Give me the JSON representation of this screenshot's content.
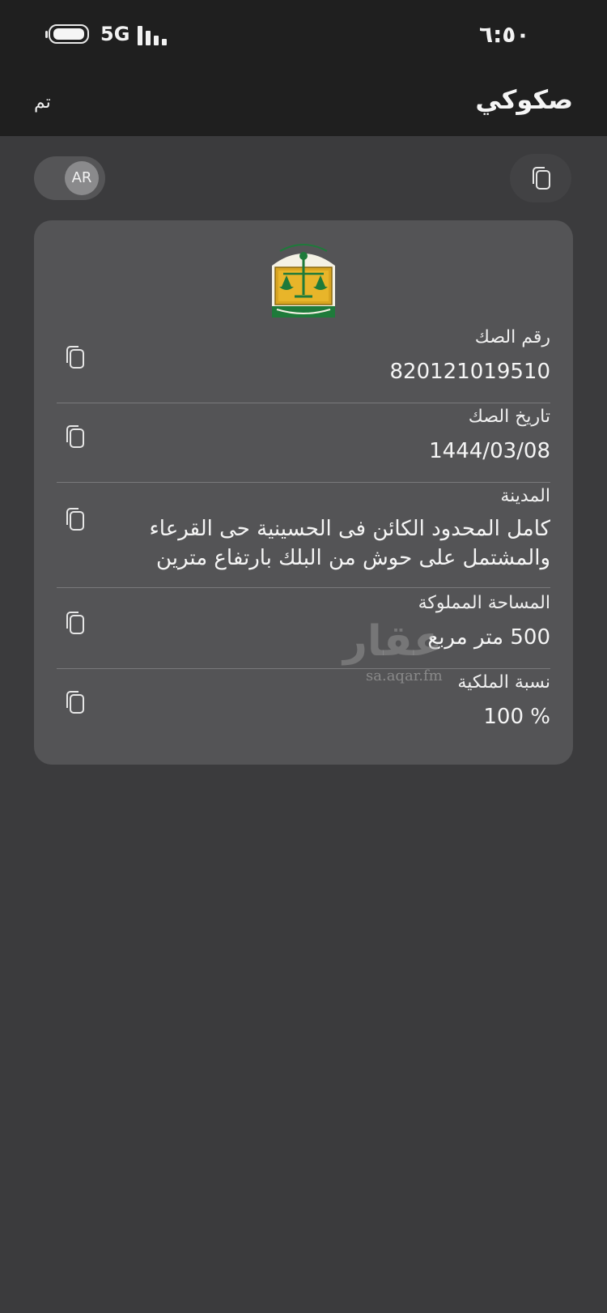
{
  "status_bar": {
    "network": "5G",
    "time": "٦:٥٠"
  },
  "nav": {
    "title": "صكوكي",
    "done_label": "تم"
  },
  "toolbar": {
    "language_toggle": "AR"
  },
  "deed": {
    "fields": [
      {
        "label": "رقم الصك",
        "value": "820121019510"
      },
      {
        "label": "تاريخ الصك",
        "value": "1444/03/08"
      },
      {
        "label": "المدينة",
        "value_lines": [
          "كامل المحدود الكائن فى الحسينية حى القرعاء",
          "والمشتمل على حوش من البلك بارتفاع مترين"
        ]
      },
      {
        "label": "المساحة المملوكة",
        "value": "500 متر مربع"
      },
      {
        "label": "نسبة الملكية",
        "value": "100 %"
      }
    ]
  },
  "watermark": {
    "brand": "عقار",
    "url": "sa.aqar.fm"
  },
  "colors": {
    "background": "#3b3b3d",
    "bar": "#1f1f1f",
    "card": "#545456",
    "logo_green": "#1e7a3a",
    "logo_gold": "#d9a520"
  }
}
